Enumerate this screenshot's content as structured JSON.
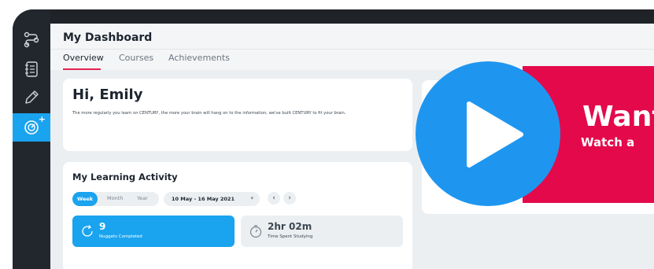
{
  "header": {
    "title": "My Dashboard"
  },
  "tabs": [
    {
      "label": "Overview",
      "active": true
    },
    {
      "label": "Courses",
      "active": false
    },
    {
      "label": "Achievements",
      "active": false
    }
  ],
  "sidebar": {
    "items": [
      {
        "icon": "route-icon",
        "active": false
      },
      {
        "icon": "notebook-icon",
        "active": false
      },
      {
        "icon": "pencil-icon",
        "active": false
      },
      {
        "icon": "dashboard-gauge-icon",
        "active": true
      }
    ]
  },
  "greeting": {
    "title": "Hi, Emily",
    "text": "The more regularly you learn on CENTURY, the more your brain will hang on to the information; we've built CENTURY to fit your brain."
  },
  "activity": {
    "title": "My Learning Activity",
    "periods": [
      "Week",
      "Month",
      "Year"
    ],
    "selected_period": "Week",
    "date_range": "10 May - 16 May 2021",
    "stats": [
      {
        "value": "9",
        "label": "Nuggets Completed"
      },
      {
        "value": "2hr 02m",
        "label": "Time Spent Studying"
      }
    ]
  },
  "promo": {
    "heading": "Want",
    "subheading": "Watch a"
  },
  "colors": {
    "accent_blue": "#1aa3ee",
    "play_blue": "#1e96f0",
    "promo_red": "#e4094b",
    "tab_underline": "#e4234f",
    "frame_dark": "#1f2328"
  }
}
